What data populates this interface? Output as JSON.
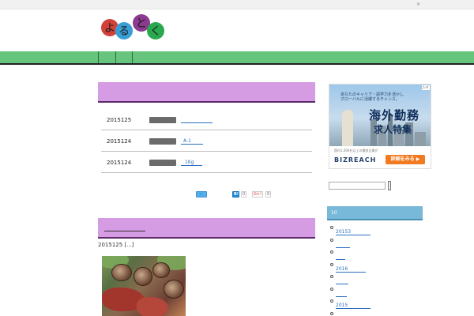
{
  "topbar": {
    "close_mark": "×"
  },
  "logo": {
    "chars": [
      "よ",
      "る",
      "と",
      "く"
    ],
    "colors": [
      "#d1413a",
      "#3a9ed6",
      "#8a3b8f",
      "#2aa84f"
    ]
  },
  "news": {
    "items": [
      {
        "date": "2015125",
        "link": ""
      },
      {
        "date": "2015124",
        "link": "A-1"
      },
      {
        "date": "2015124",
        "link": "1Kg"
      }
    ]
  },
  "share": {
    "twitter_icon": "twitter-icon",
    "hatena_label": "B!",
    "hatena_count": "0",
    "gplus_label": "G+!",
    "gplus_count": "0"
  },
  "post": {
    "meta": "2015125 [...]"
  },
  "ad": {
    "subtitle_line1": "あなたのキャリア・語学力を活かし",
    "subtitle_line2": "グローバルに活躍するチャンス。",
    "title_line1": "海外勤務",
    "title_line2": "求人特集",
    "small_text": "国内1,000社以上の優良企業が",
    "brand": "BIZREACH",
    "button": "詳細をみる ▶",
    "close": "▷×"
  },
  "sidebar": {
    "search_placeholder": "",
    "archive_title": "10",
    "archive_items": [
      "20153",
      "",
      "",
      "2016",
      "",
      "",
      "2015",
      ""
    ]
  },
  "colors": {
    "nav": "#66c47d",
    "panel": "#d59be3",
    "archive_header": "#78b8d8",
    "link": "#2a6fbf"
  }
}
